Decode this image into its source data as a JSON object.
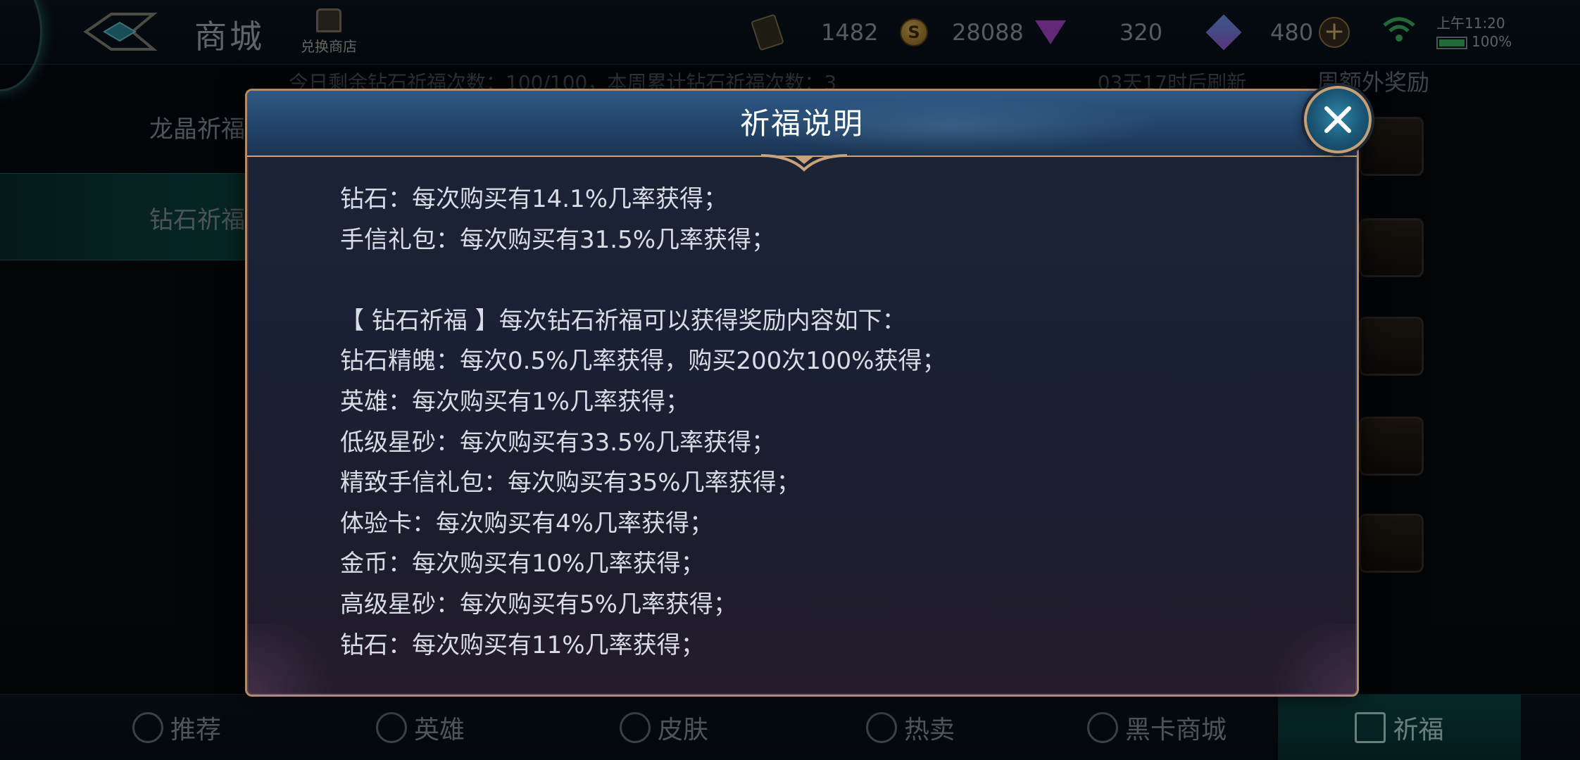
{
  "topbar": {
    "title": "商城",
    "exchange_label": "兑换商店",
    "currencies": {
      "ticket": "1482",
      "gold": "28088",
      "diamond": "320",
      "crystal": "480"
    },
    "coin_glyph": "S",
    "plus_glyph": "+",
    "time": "上午11:20",
    "battery": "100%"
  },
  "left_tabs": [
    {
      "label": "龙晶祈福"
    },
    {
      "label": "钻石祈福"
    }
  ],
  "info_strip": {
    "left": "今日剩余钻石祈福次数：100/100，本周累计钻石祈福次数：3",
    "right": "03天17时后刷新"
  },
  "side_title": "周额外奖励",
  "bottom_tabs": [
    {
      "label": "推荐"
    },
    {
      "label": "英雄"
    },
    {
      "label": "皮肤"
    },
    {
      "label": "热卖"
    },
    {
      "label": "黑卡商城"
    },
    {
      "label": "祈福"
    }
  ],
  "modal": {
    "title": "祈福说明",
    "lines": [
      "钻石：每次购买有14.1%几率获得；",
      "手信礼包：每次购买有31.5%几率获得；",
      "",
      "【 钻石祈福 】每次钻石祈福可以获得奖励内容如下：",
      "钻石精魄：每次0.5%几率获得，购买200次100%获得；",
      "英雄：每次购买有1%几率获得；",
      "低级星砂：每次购买有33.5%几率获得；",
      "精致手信礼包：每次购买有35%几率获得；",
      "体验卡：每次购买有4%几率获得；",
      "金币：每次购买有10%几率获得；",
      "高级星砂：每次购买有5%几率获得；",
      "钻石：每次购买有11%几率获得；"
    ]
  },
  "colors": {
    "accent_teal": "#0d4b4c",
    "gold_border": "#b38b66",
    "modal_header_blue": "#2f5a84"
  }
}
